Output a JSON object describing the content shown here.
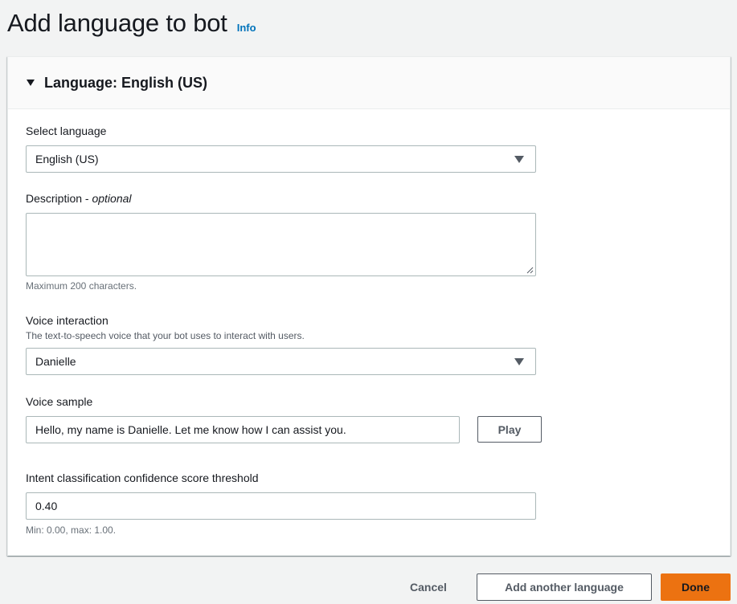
{
  "page": {
    "title": "Add language to bot",
    "info_link": "Info"
  },
  "panel": {
    "title": "Language: English (US)",
    "expanded": true
  },
  "select_language": {
    "label": "Select language",
    "value": "English (US)"
  },
  "description": {
    "label": "Description - ",
    "label_suffix": "optional",
    "value": "",
    "hint": "Maximum 200 characters."
  },
  "voice_interaction": {
    "label": "Voice interaction",
    "description": "The text-to-speech voice that your bot uses to interact with users.",
    "value": "Danielle"
  },
  "voice_sample": {
    "label": "Voice sample",
    "value": "Hello, my name is Danielle. Let me know how I can assist you.",
    "play_label": "Play"
  },
  "confidence_threshold": {
    "label": "Intent classification confidence score threshold",
    "value": "0.40",
    "hint": "Min: 0.00, max: 1.00."
  },
  "footer": {
    "cancel_label": "Cancel",
    "add_another_label": "Add another language",
    "done_label": "Done"
  },
  "colors": {
    "link": "#0073bb",
    "primary_button": "#ec7211",
    "background": "#f2f3f3"
  }
}
